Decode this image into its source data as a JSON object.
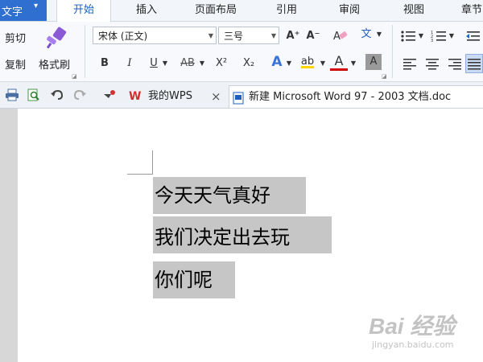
{
  "ribbon_tabs": {
    "app_menu": "文字",
    "items": [
      "开始",
      "插入",
      "页面布局",
      "引用",
      "审阅",
      "视图",
      "章节"
    ]
  },
  "clipboard": {
    "cut": "剪切",
    "copy": "复制",
    "format_painter": "格式刷"
  },
  "font": {
    "family": "宋体 (正文)",
    "size": "三号",
    "grow_icon": "A⁺",
    "shrink_icon": "A⁻",
    "clear_format_icon": "eraser-A",
    "phonetic_icon": "文",
    "bold": "B",
    "italic": "I",
    "underline": "U",
    "strikethrough": "AB",
    "superscript": "X²",
    "subscript": "X₂",
    "text_effect": "A",
    "highlight": "ab",
    "font_color": "A",
    "char_shading": "A",
    "font_color_hex": "#d00000",
    "highlight_color_hex": "#ffd400"
  },
  "quick_access": {
    "items": [
      "print-icon",
      "print-preview-icon",
      "undo-icon",
      "redo-icon",
      "customize-icon"
    ]
  },
  "doc_tabs": {
    "wps_tab": "我的WPS",
    "wps_close": "×",
    "document_tab": "新建 Microsoft Word 97 - 2003 文档.doc"
  },
  "document": {
    "lines": [
      "今天天气真好",
      "我们决定出去玩",
      "你们呢"
    ]
  },
  "watermark": {
    "logo": "Bai 经验",
    "url": "jingyan.baidu.com"
  }
}
